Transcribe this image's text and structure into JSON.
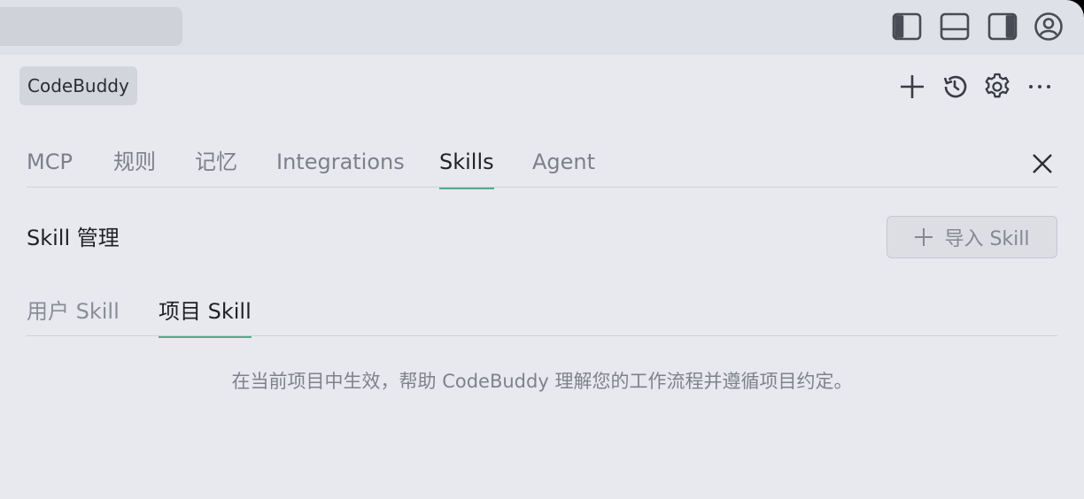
{
  "topbar": {
    "icons": [
      "panel-left-icon",
      "panel-bottom-icon",
      "panel-right-icon",
      "account-icon"
    ]
  },
  "header": {
    "chip_label": "CodeBuddy",
    "actions": [
      "plus-icon",
      "history-icon",
      "gear-icon",
      "more-icon"
    ]
  },
  "tabs": [
    {
      "label": "MCP",
      "active": false
    },
    {
      "label": "规则",
      "active": false
    },
    {
      "label": "记忆",
      "active": false
    },
    {
      "label": "Integrations",
      "active": false
    },
    {
      "label": "Skills",
      "active": true
    },
    {
      "label": "Agent",
      "active": false
    }
  ],
  "section": {
    "title": "Skill 管理",
    "import_button": "导入 Skill"
  },
  "subtabs": [
    {
      "label": "用户 Skill",
      "active": false
    },
    {
      "label": "项目 Skill",
      "active": true
    }
  ],
  "description": "在当前项目中生效，帮助 CodeBuddy 理解您的工作流程并遵循项目约定。",
  "colors": {
    "accent": "#4fae8a",
    "background": "#e8e9ee"
  }
}
